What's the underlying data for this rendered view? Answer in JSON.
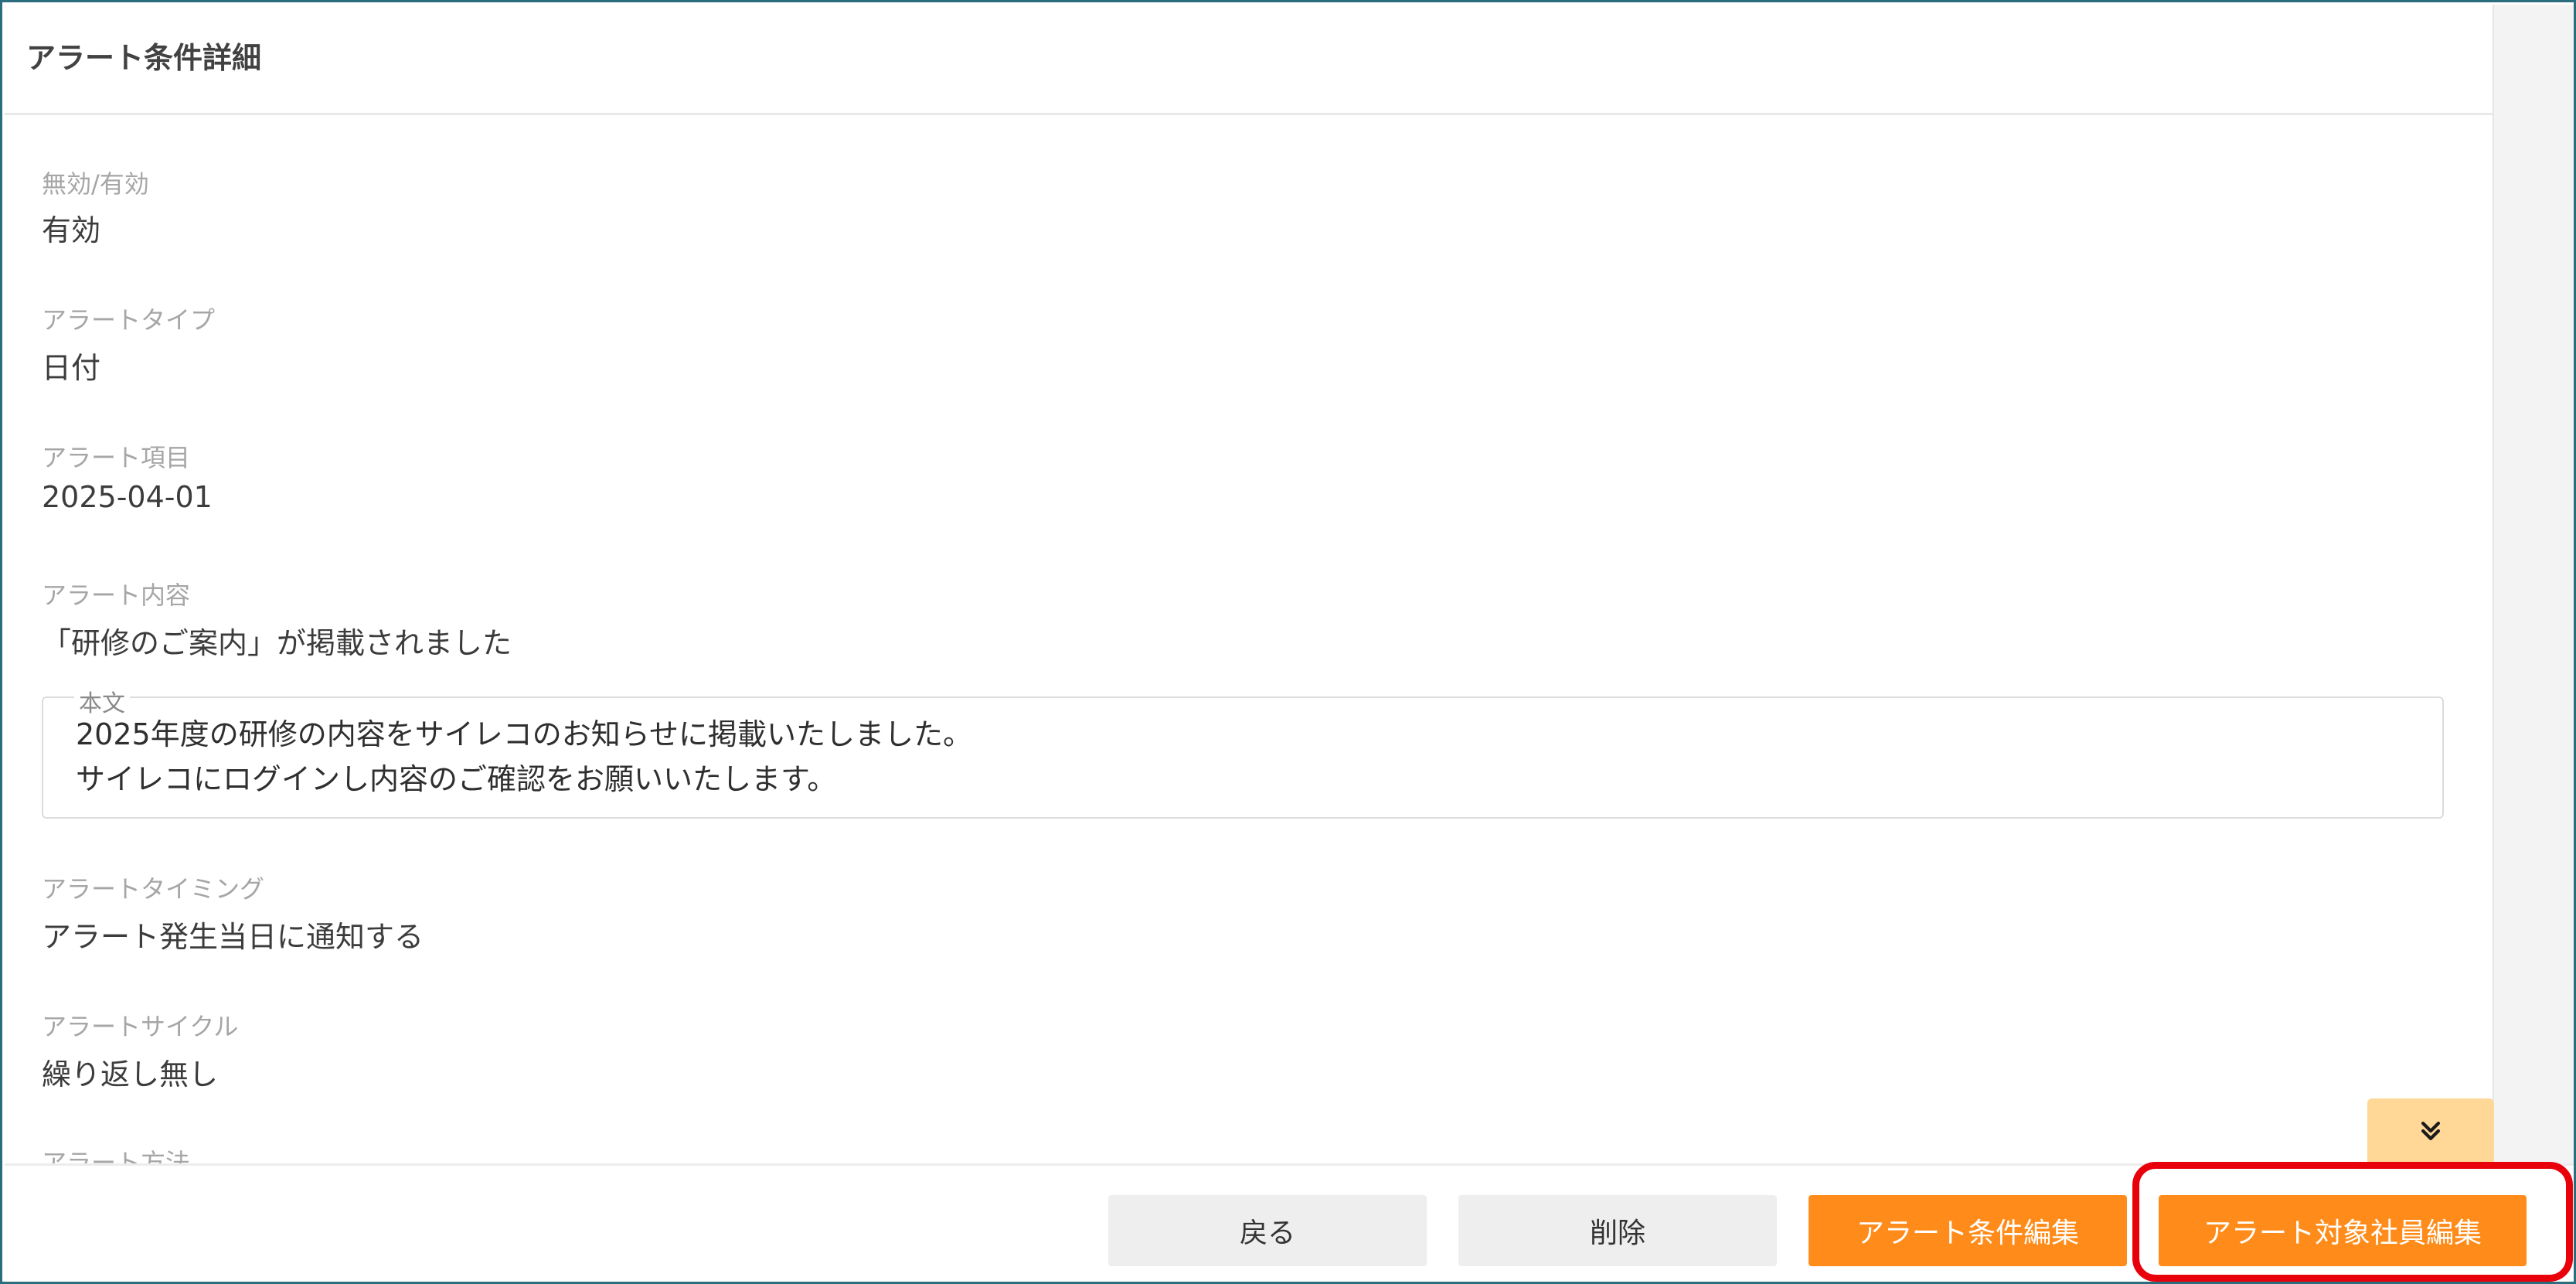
{
  "header": {
    "title": "アラート条件詳細"
  },
  "fields": [
    {
      "label": "無効/有効",
      "value": "有効"
    },
    {
      "label": "アラートタイプ",
      "value": "日付"
    },
    {
      "label": "アラート項目",
      "value": "2025-04-01"
    },
    {
      "label": "アラート内容",
      "value": "「研修のご案内」が掲載されました"
    },
    {
      "label": "アラートタイミング",
      "value": "アラート発生当日に通知する"
    },
    {
      "label": "アラートサイクル",
      "value": "繰り返し無し"
    },
    {
      "label": "アラート方法",
      "value": ""
    }
  ],
  "body": {
    "legend": "本文",
    "lines": [
      "2025年度の研修の内容をサイレコのお知らせに掲載いたしました。",
      "サイレコにログインし内容のご確認をお願いいたします。"
    ]
  },
  "scroll_button": {
    "icon": "double-chevron-down-icon"
  },
  "footer": {
    "back_label": "戻る",
    "delete_label": "削除",
    "edit_condition_label": "アラート条件編集",
    "edit_target_label": "アラート対象社員編集"
  },
  "colors": {
    "accent": "#ff8c1a",
    "highlight": "#e8000b",
    "frame": "#2a6e7e",
    "scroll_button": "#ffd897"
  }
}
